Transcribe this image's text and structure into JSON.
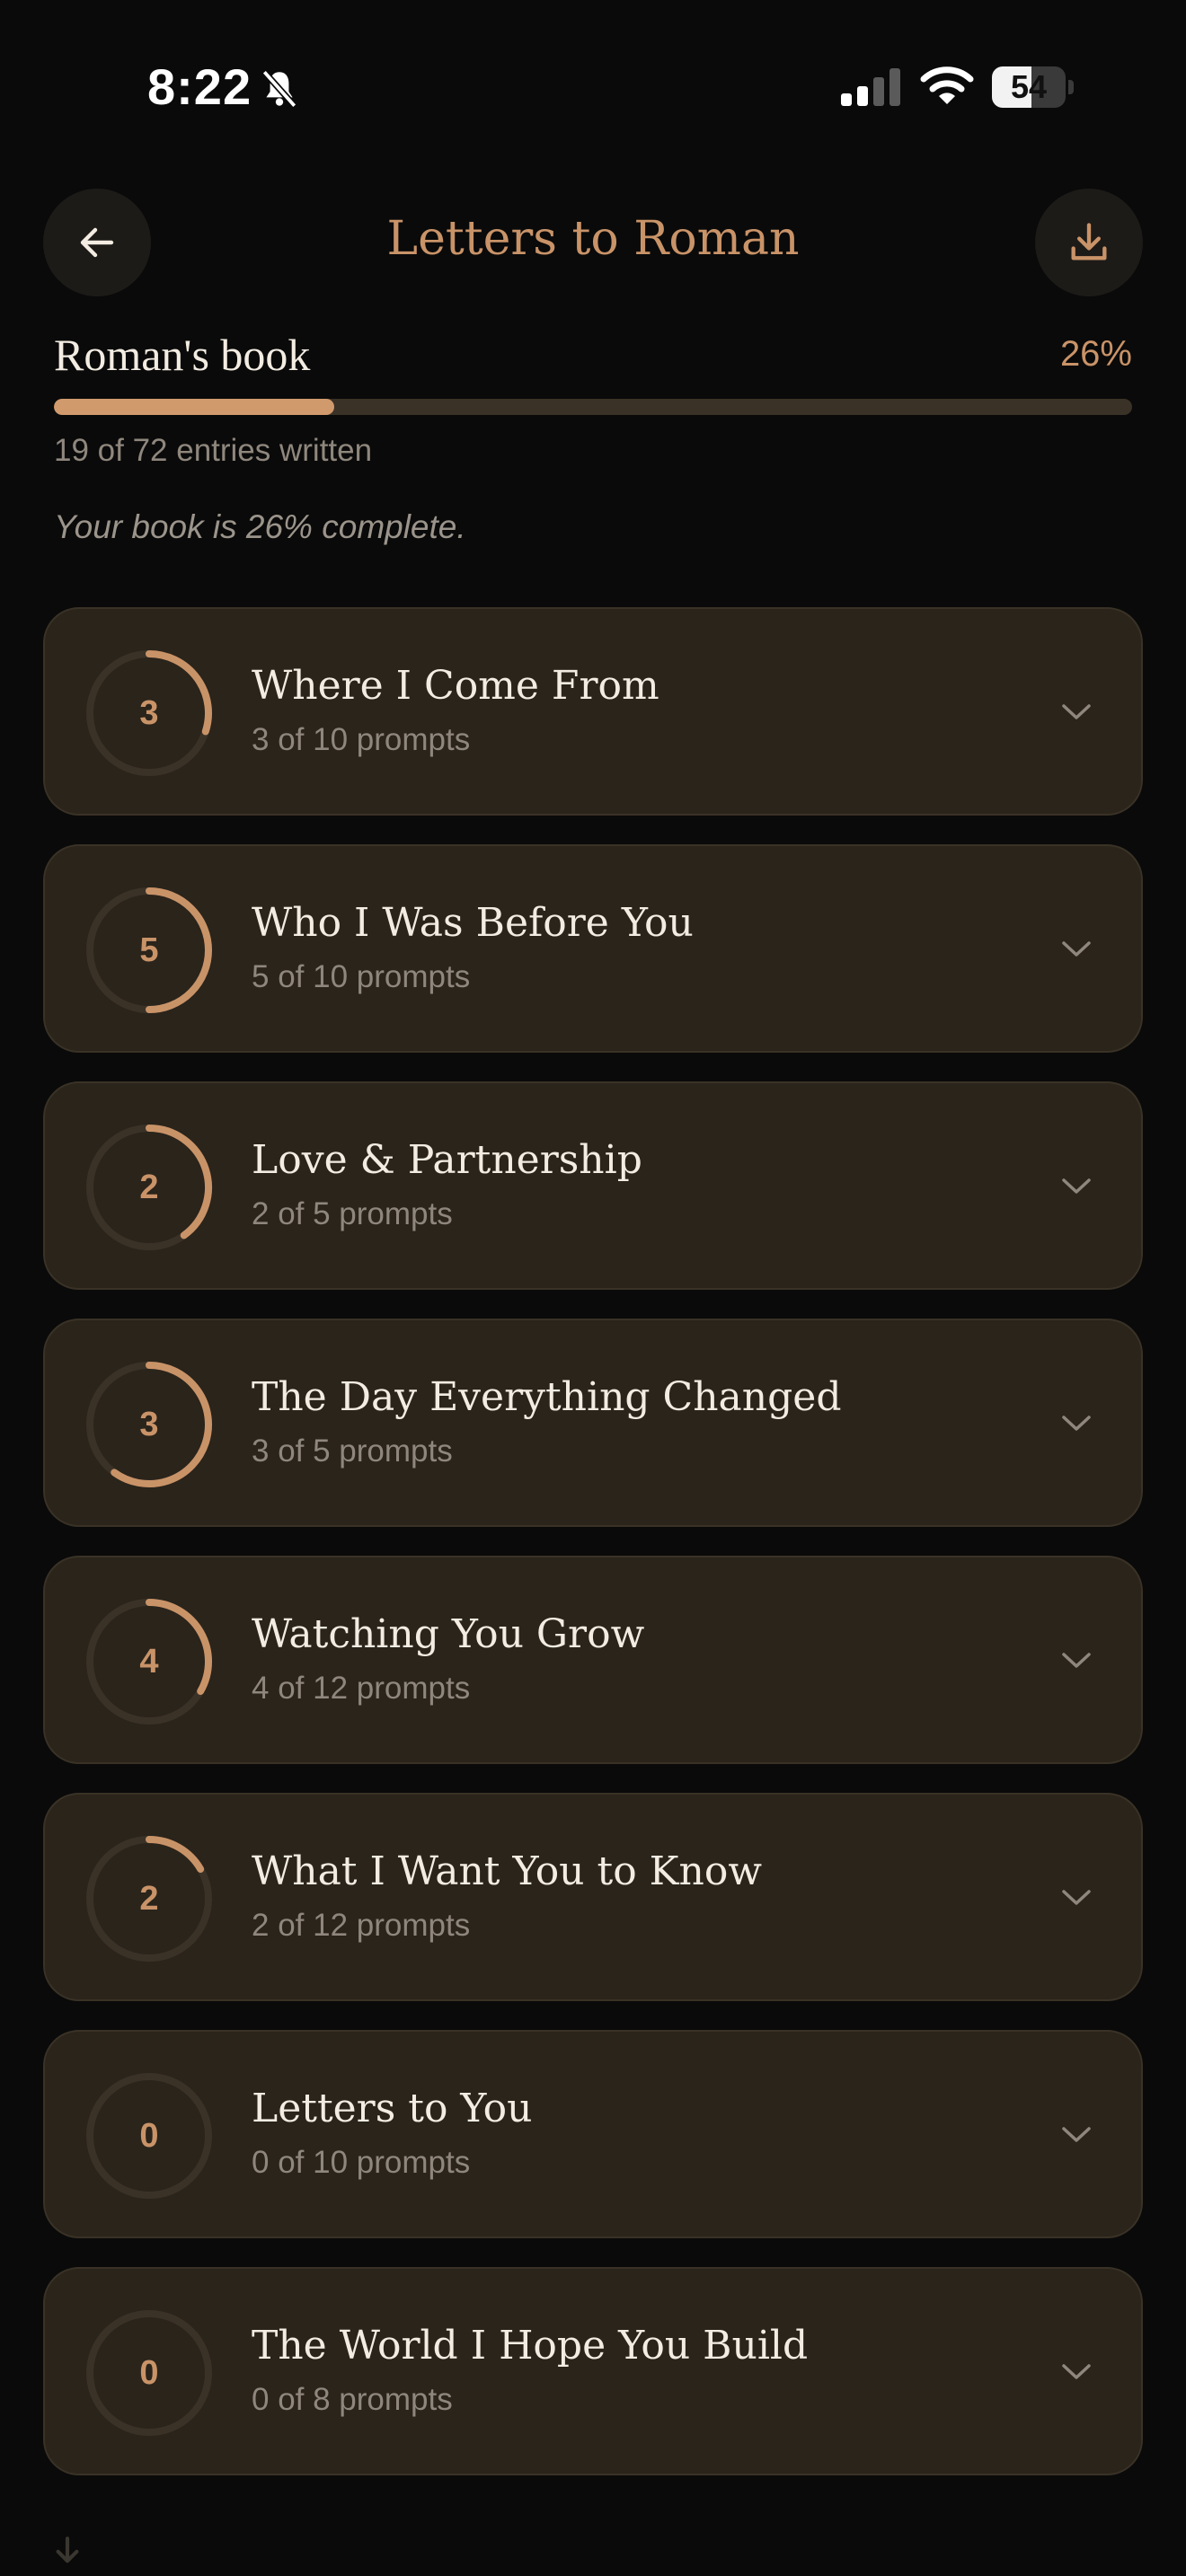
{
  "status_bar": {
    "time": "8:22",
    "battery": "54",
    "battery_level": 0.54,
    "icons": [
      "bell-slash-icon",
      "cellular-signal-icon",
      "wifi-icon",
      "battery-icon"
    ]
  },
  "header": {
    "title": "Letters to Roman",
    "back_icon": "arrow-left-icon",
    "download_icon": "download-icon"
  },
  "progress": {
    "book_name": "Roman's book",
    "percent_label": "26%",
    "percent_value": 0.26,
    "entries_text": "19 of 72 entries written",
    "complete_text": "Your book is 26% complete."
  },
  "sections": [
    {
      "count": "3",
      "title": "Where I Come From",
      "subtitle": "3 of 10 prompts",
      "done": 3,
      "total": 10
    },
    {
      "count": "5",
      "title": "Who I Was Before You",
      "subtitle": "5 of 10 prompts",
      "done": 5,
      "total": 10
    },
    {
      "count": "2",
      "title": "Love & Partnership",
      "subtitle": "2 of 5 prompts",
      "done": 2,
      "total": 5
    },
    {
      "count": "3",
      "title": "The Day Everything Changed",
      "subtitle": "3 of 5 prompts",
      "done": 3,
      "total": 5
    },
    {
      "count": "4",
      "title": "Watching You Grow",
      "subtitle": "4 of 12 prompts",
      "done": 4,
      "total": 12
    },
    {
      "count": "2",
      "title": "What I Want You to Know",
      "subtitle": "2 of 12 prompts",
      "done": 2,
      "total": 12
    },
    {
      "count": "0",
      "title": "Letters to You",
      "subtitle": "0 of 10 prompts",
      "done": 0,
      "total": 10
    },
    {
      "count": "0",
      "title": "The World I Hope You Build",
      "subtitle": "0 of 8 prompts",
      "done": 0,
      "total": 8
    }
  ],
  "colors": {
    "accent": "#c99368",
    "background": "#0a0a0a",
    "card": "#2a241b",
    "ring_track": "#3b3227"
  }
}
